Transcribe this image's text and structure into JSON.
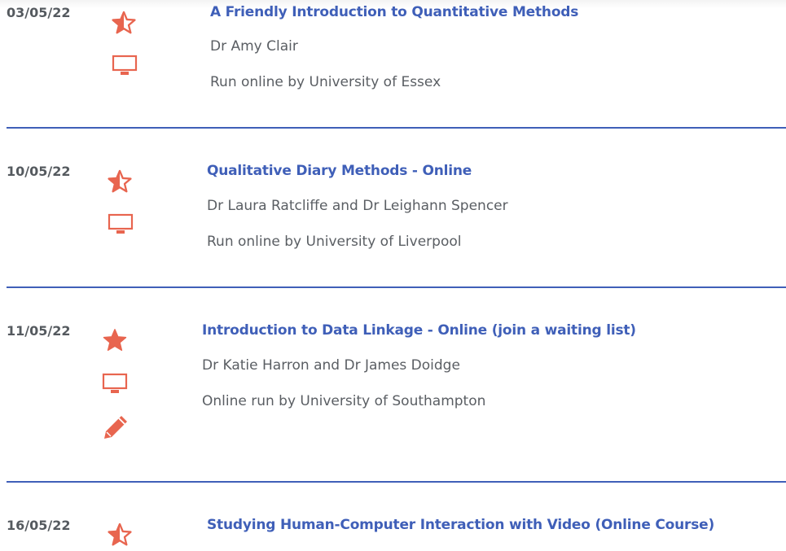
{
  "events": [
    {
      "date": "03/05/22",
      "title": "A Friendly Introduction to Quantitative Methods",
      "presenter": "Dr Amy Clair",
      "organiser": "Run online by University of Essex",
      "icons": [
        "star-half-icon",
        "monitor-icon"
      ]
    },
    {
      "date": "10/05/22",
      "title": "Qualitative Diary Methods - Online",
      "presenter": "Dr Laura Ratcliffe and Dr Leighann Spencer",
      "organiser": "Run online by University of Liverpool",
      "icons": [
        "star-half-icon",
        "monitor-icon"
      ]
    },
    {
      "date": "11/05/22",
      "title": "Introduction to Data Linkage - Online (join a waiting list)",
      "presenter": "Dr Katie Harron and Dr James Doidge",
      "organiser": "Online run by University of Southampton",
      "icons": [
        "star-full-icon",
        "monitor-icon",
        "pencil-icon"
      ]
    },
    {
      "date": "16/05/22",
      "title": "Studying Human-Computer Interaction with Video (Online Course)",
      "icons": [
        "star-half-icon"
      ]
    }
  ],
  "colors": {
    "title": "#3f5fb8",
    "icon": "#e8654f",
    "separator": "#3f5fb8",
    "text": "#5a5e63",
    "date": "#555a5f"
  }
}
